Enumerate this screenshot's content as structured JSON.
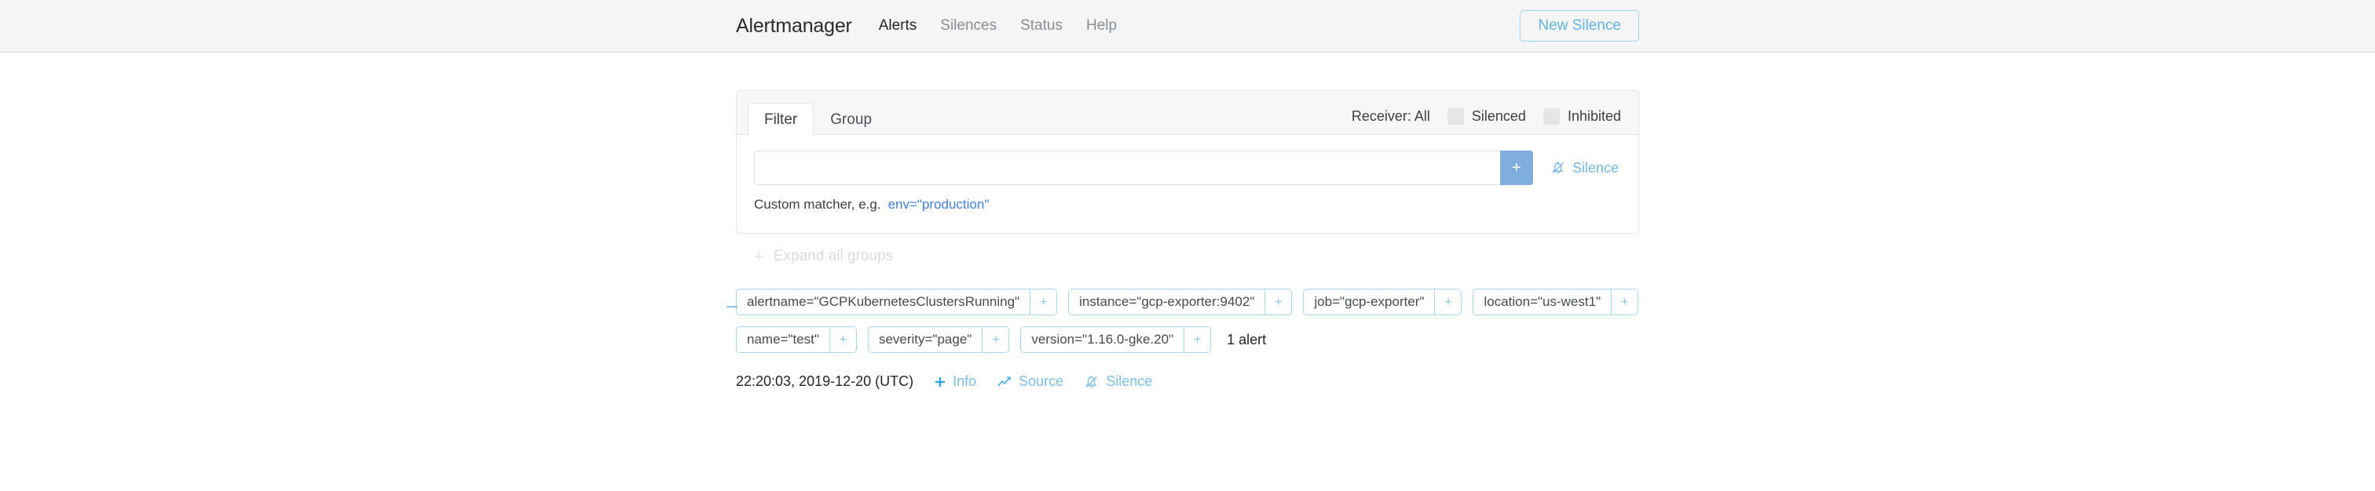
{
  "navbar": {
    "brand": "Alertmanager",
    "links": [
      {
        "label": "Alerts",
        "active": true
      },
      {
        "label": "Silences",
        "active": false
      },
      {
        "label": "Status",
        "active": false
      },
      {
        "label": "Help",
        "active": false
      }
    ],
    "new_silence_button": "New Silence"
  },
  "filter_card": {
    "tabs": [
      {
        "label": "Filter",
        "active": true
      },
      {
        "label": "Group",
        "active": false
      }
    ],
    "receiver_label": "Receiver: All",
    "toggles": [
      {
        "label": "Silenced",
        "checked": false
      },
      {
        "label": "Inhibited",
        "checked": false
      }
    ],
    "matcher_input": {
      "value": "",
      "placeholder": ""
    },
    "add_button_label": "+",
    "silence_action": "Silence",
    "hint_prefix": "Custom matcher, e.g.",
    "hint_code": "env=\"production\""
  },
  "expand_all": {
    "label": "Expand all groups",
    "icon": "plus-icon"
  },
  "alert_group": {
    "collapse_icon": "minus-icon",
    "labels": [
      "alertname=\"GCPKubernetesClustersRunning\"",
      "instance=\"gcp-exporter:9402\"",
      "job=\"gcp-exporter\"",
      "location=\"us-west1\"",
      "name=\"test\"",
      "severity=\"page\"",
      "version=\"1.16.0-gke.20\""
    ],
    "chip_plus_label": "+",
    "alert_count": "1 alert",
    "alerts": [
      {
        "timestamp": "22:20:03, 2019-12-20 (UTC)",
        "actions": [
          {
            "label": "Info",
            "icon": "plus-icon"
          },
          {
            "label": "Source",
            "icon": "chart-line-icon"
          },
          {
            "label": "Silence",
            "icon": "bell-slash-icon"
          }
        ]
      }
    ]
  },
  "colors": {
    "accent_blue": "#7fadde",
    "link_blue": "#76b8e6",
    "chip_border": "#a8d4ec",
    "navbar_bg": "#f5f5f5",
    "code_blue": "#3f82e2"
  }
}
